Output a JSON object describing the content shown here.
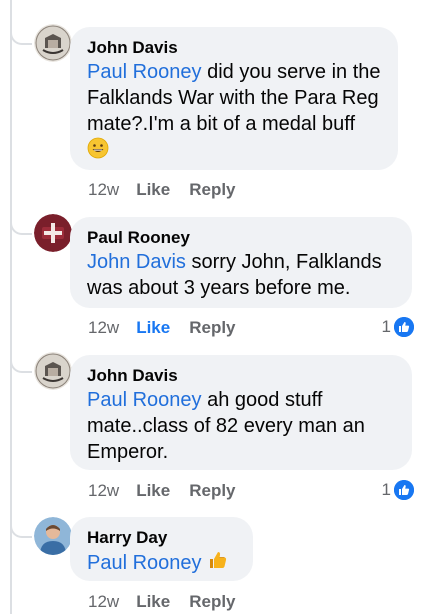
{
  "comments": [
    {
      "author": "John Davis",
      "mention": "Paul Rooney",
      "text_line1_rest": " did you serve in the",
      "text_line2": "Falklands War with the Para Reg",
      "text_line3": "mate?.I'm a bit of a medal buff",
      "emoji": "grinning-face-emoji",
      "time": "12w",
      "like_label": "Like",
      "reply_label": "Reply"
    },
    {
      "author": "Paul Rooney",
      "mention": "John Davis",
      "text_line1_rest": " sorry John, Falklands",
      "text_line2": "was about 3 years before me.",
      "time": "12w",
      "like_label": "Like",
      "liked": true,
      "reply_label": "Reply",
      "reaction_count": "1"
    },
    {
      "author": "John Davis",
      "mention": "Paul Rooney",
      "text_line1_rest": " ah good stuff",
      "text_line2": "mate..class of 82 every man an",
      "text_line3": "Emperor.",
      "time": "12w",
      "like_label": "Like",
      "reply_label": "Reply",
      "reaction_count": "1"
    },
    {
      "author": "Harry Day",
      "mention": "Paul Rooney",
      "emoji": "thumbs-up-emoji",
      "time": "12w",
      "like_label": "Like",
      "reply_label": "Reply"
    }
  ],
  "colors": {
    "bubble": "#f0f2f5",
    "mention": "#216fdb",
    "meta": "#65676b",
    "like_active": "#1877f2"
  }
}
